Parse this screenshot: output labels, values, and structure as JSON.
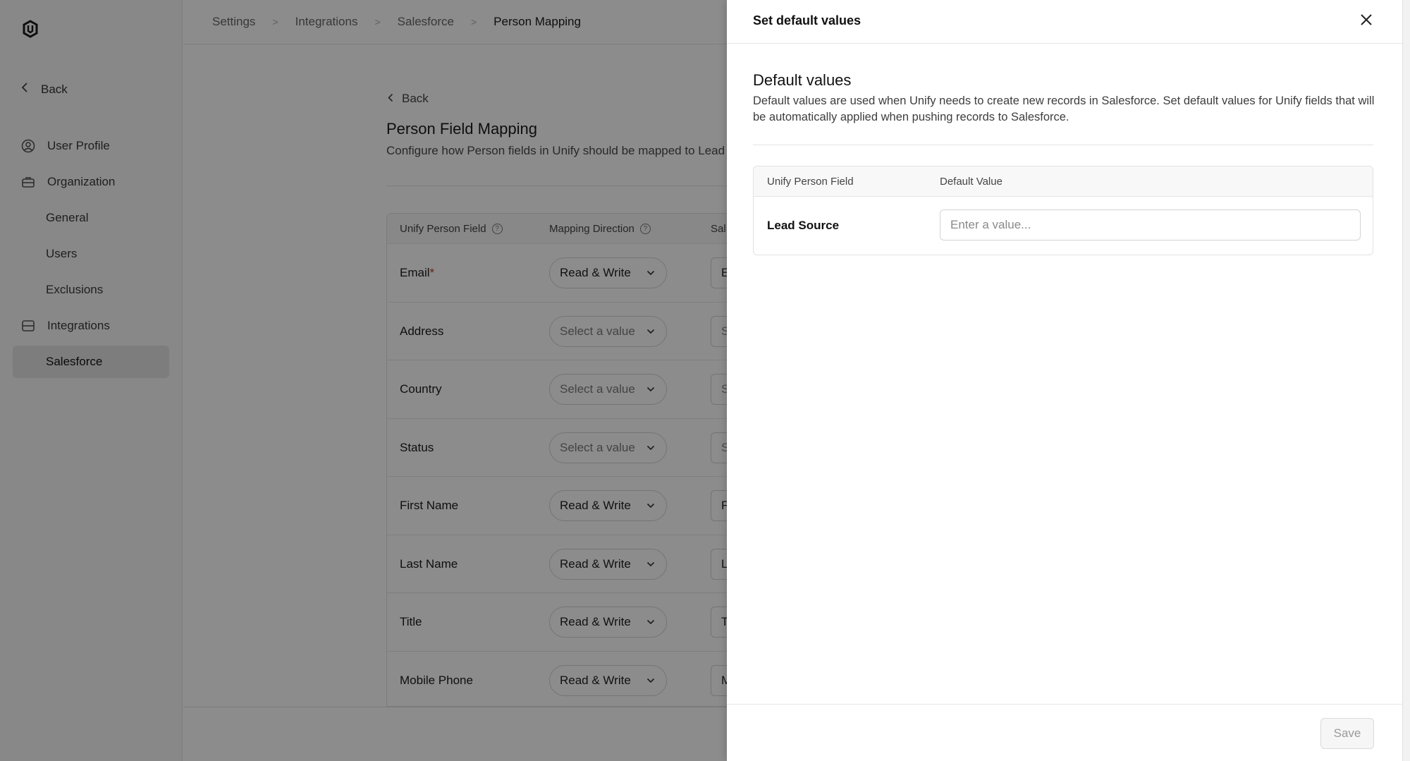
{
  "sidebar": {
    "back_label": "Back",
    "items": [
      {
        "label": "User Profile",
        "icon": "user-circle-icon"
      },
      {
        "label": "Organization",
        "icon": "briefcase-icon"
      },
      {
        "label": "General"
      },
      {
        "label": "Users"
      },
      {
        "label": "Exclusions"
      },
      {
        "label": "Integrations",
        "icon": "server-icon"
      },
      {
        "label": "Salesforce",
        "active": true
      }
    ]
  },
  "breadcrumb": [
    "Settings",
    "Integrations",
    "Salesforce",
    "Person Mapping"
  ],
  "main": {
    "back_label": "Back",
    "title": "Person Field Mapping",
    "description": "Configure how Person fields in Unify should be mapped to Lead and",
    "table": {
      "headers": [
        "Unify Person Field",
        "Mapping Direction",
        "Sal"
      ],
      "rows": [
        {
          "field": "Email",
          "required_mark": "*",
          "direction": "Read & Write",
          "sf": "E"
        },
        {
          "field": "Address",
          "direction": "Select a value",
          "sf": "S"
        },
        {
          "field": "Country",
          "direction": "Select a value",
          "sf": "S"
        },
        {
          "field": "Status",
          "direction": "Select a value",
          "sf": "S"
        },
        {
          "field": "First Name",
          "direction": "Read & Write",
          "sf": "F"
        },
        {
          "field": "Last Name",
          "direction": "Read & Write",
          "sf": "L"
        },
        {
          "field": "Title",
          "direction": "Read & Write",
          "sf": "T"
        },
        {
          "field": "Mobile Phone",
          "direction": "Read & Write",
          "sf": "M"
        }
      ]
    }
  },
  "drawer": {
    "title": "Set default values",
    "section_title": "Default values",
    "section_description": "Default values are used when Unify needs to create new records in Salesforce. Set default values for Unify fields that will be automatically applied when pushing records to Salesforce.",
    "table": {
      "headers": [
        "Unify Person Field",
        "Default Value"
      ],
      "rows": [
        {
          "field": "Lead Source",
          "value": "",
          "placeholder": "Enter a value..."
        }
      ]
    },
    "save_label": "Save"
  }
}
